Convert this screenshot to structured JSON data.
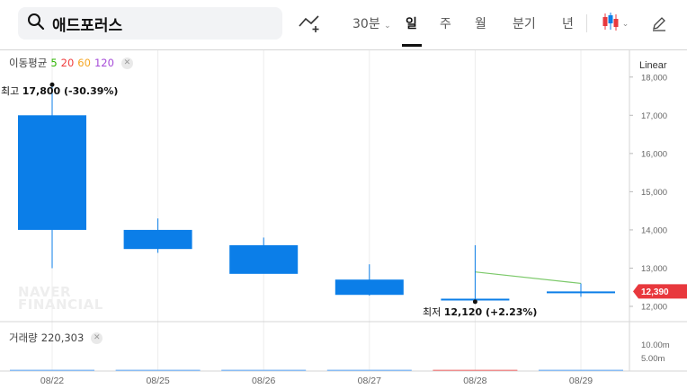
{
  "search": {
    "query": "애드포러스"
  },
  "toolbar": {
    "periods": [
      "30분",
      "일",
      "주",
      "월",
      "분기",
      "년"
    ],
    "active_period": "일",
    "scale_mode": "Linear"
  },
  "legend": {
    "ma_label": "이동평균",
    "ma_periods": [
      "5",
      "20",
      "60",
      "120"
    ],
    "ma_colors": [
      "#2db400",
      "#f03c3c",
      "#f5a623",
      "#a64bd8"
    ],
    "volume_label": "거래량",
    "volume_value": "220,303"
  },
  "annotations": {
    "high_prefix": "최고",
    "high_value": "17,800 (-30.39%)",
    "low_prefix": "최저",
    "low_value": "12,120 (+2.23%)"
  },
  "current_price_tag": "12,390",
  "watermark": [
    "NAVER",
    "FINANCIAL"
  ],
  "colors": {
    "down": "#0b7ee8",
    "up": "#ee7070",
    "volume_down": "#8bbdf3",
    "accent_price": "#e8383d",
    "ma_line": "#7cc96a"
  },
  "chart_data": {
    "type": "candlestick",
    "categories": [
      "08/22",
      "08/25",
      "08/26",
      "08/27",
      "08/28",
      "08/29"
    ],
    "series": [
      {
        "open": 17000,
        "high": 17800,
        "low": 13000,
        "close": 14000
      },
      {
        "open": 14000,
        "high": 14300,
        "low": 13400,
        "close": 13500
      },
      {
        "open": 13600,
        "high": 13800,
        "low": 12900,
        "close": 12850
      },
      {
        "open": 12700,
        "high": 13100,
        "low": 12280,
        "close": 12300
      },
      {
        "open": 12200,
        "high": 13600,
        "low": 12120,
        "close": 12200
      },
      {
        "open": 12390,
        "high": 12600,
        "low": 12250,
        "close": 12390
      }
    ],
    "ma_line": {
      "from": "08/28",
      "to": "08/29",
      "values": [
        12900,
        12600
      ]
    },
    "y_ticks": [
      12000,
      13000,
      14000,
      15000,
      16000,
      17000,
      18000
    ],
    "y_tick_labels": [
      "12,000",
      "13,000",
      "14,000",
      "15,000",
      "16,000",
      "17,000",
      "18,000"
    ],
    "ylim": [
      11600,
      18700
    ],
    "volume": {
      "values": [
        220303,
        9000,
        5000,
        4500,
        12000,
        500
      ],
      "directions": [
        "down",
        "down",
        "down",
        "down",
        "up",
        "down"
      ],
      "ticks": [
        5000000,
        10000000
      ],
      "tick_labels": [
        "5.00m",
        "10.00m"
      ],
      "ylim": [
        0,
        18000000
      ]
    }
  }
}
